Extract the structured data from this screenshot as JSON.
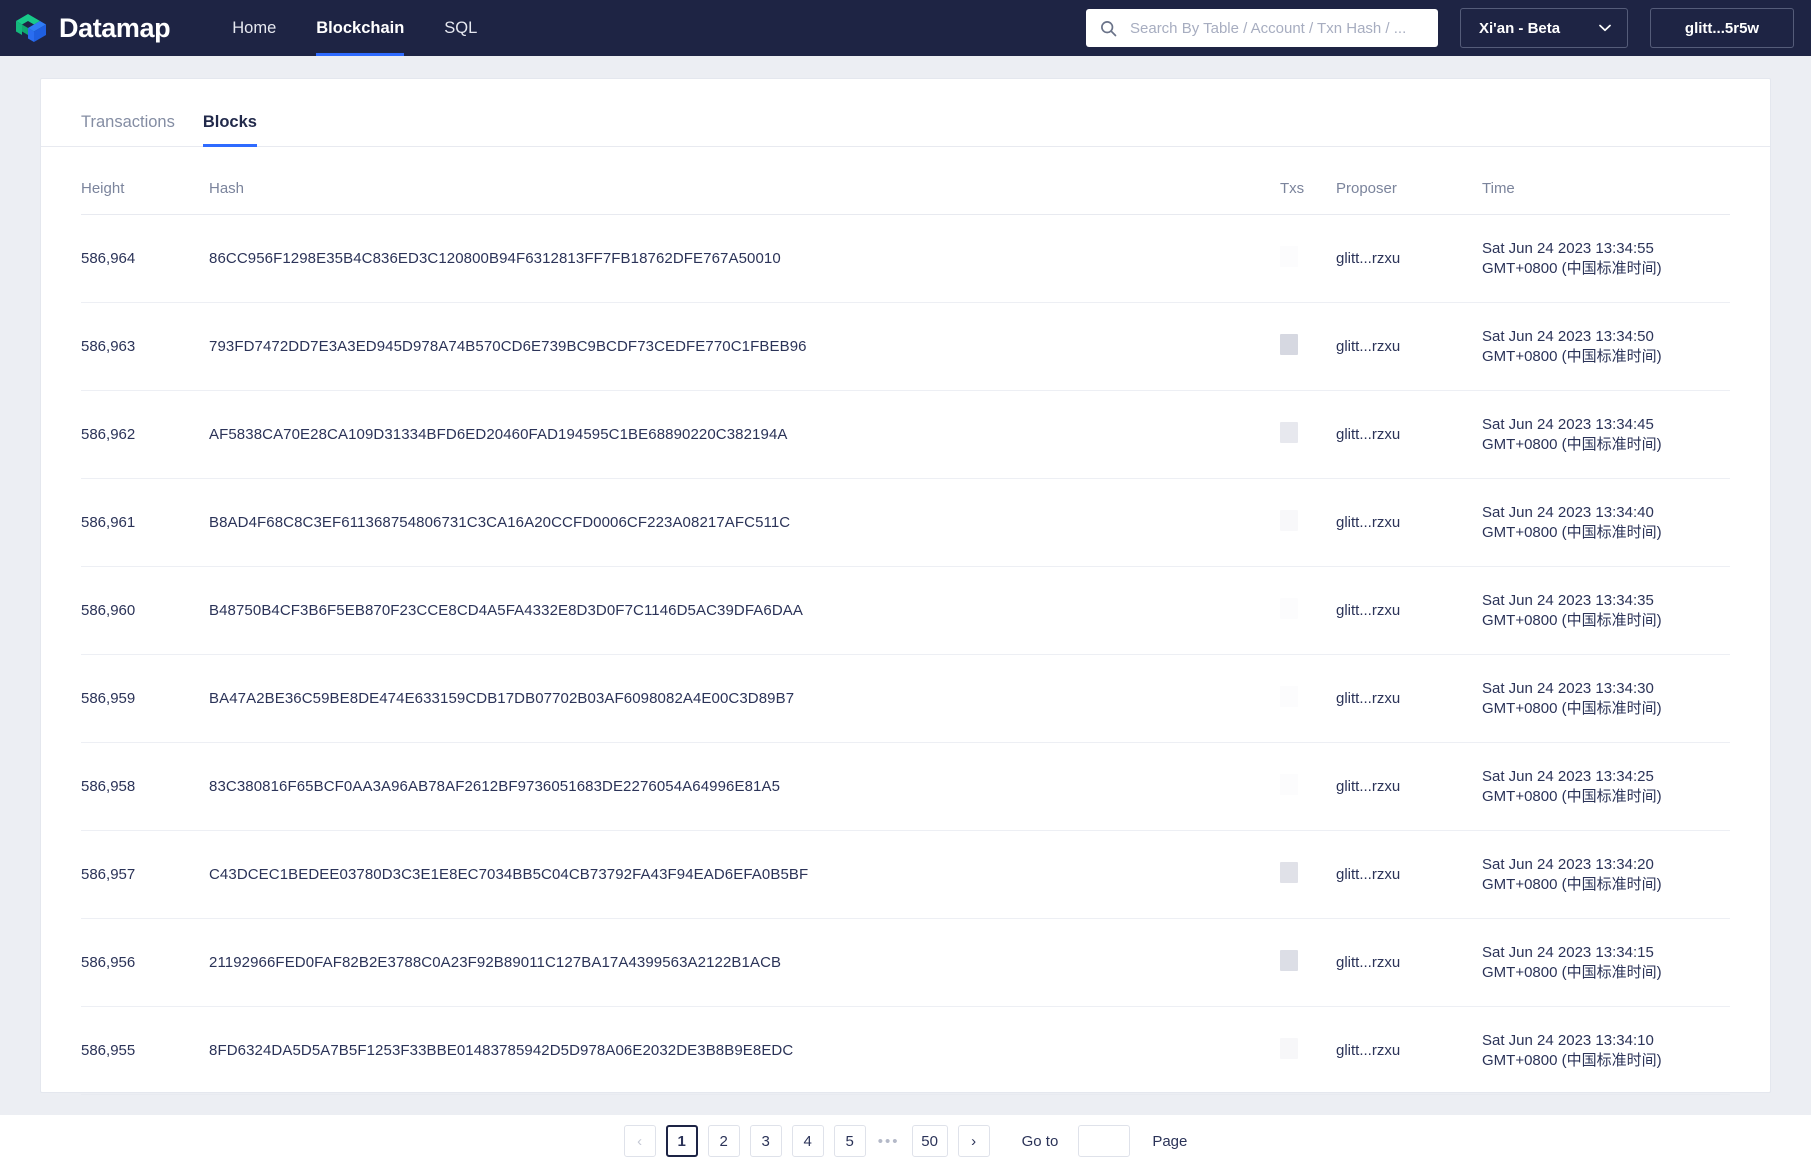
{
  "header": {
    "brand": "Datamap",
    "logo_icon": "datamap-logo-icon",
    "nav": [
      {
        "label": "Home",
        "active": false
      },
      {
        "label": "Blockchain",
        "active": true
      },
      {
        "label": "SQL",
        "active": false
      }
    ],
    "search": {
      "icon": "search-icon",
      "placeholder": "Search By Table / Account / Txn Hash / ...",
      "value": ""
    },
    "network": {
      "label": "Xi'an - Beta",
      "chevron": "chevron-down-icon"
    },
    "account": {
      "label": "glitt...5r5w"
    },
    "accent_color": "#2f6bff",
    "nav_background": "#1e2444"
  },
  "tabs": [
    {
      "label": "Transactions",
      "active": false
    },
    {
      "label": "Blocks",
      "active": true
    }
  ],
  "table": {
    "columns": [
      "Height",
      "Hash",
      "Txs",
      "Proposer",
      "Time"
    ],
    "rows": [
      {
        "height": "586,964",
        "hash": "86CC956F1298E35B4C836ED3C120800B94F6312813FF7FB18762DFE767A50010",
        "txs": "",
        "txs_skeleton_opacity": 0.05,
        "proposer": "glitt...rzxu",
        "time_line1": "Sat Jun 24 2023 13:34:55",
        "time_line2": "GMT+0800 (中国标准时间)"
      },
      {
        "height": "586,963",
        "hash": "793FD7472DD7E3A3ED945D978A74B570CD6E739BC9BCDF73CEDFE770C1FBEB96",
        "txs": "",
        "txs_skeleton_opacity": 0.72,
        "proposer": "glitt...rzxu",
        "time_line1": "Sat Jun 24 2023 13:34:50",
        "time_line2": "GMT+0800 (中国标准时间)"
      },
      {
        "height": "586,962",
        "hash": "AF5838CA70E28CA109D31334BFD6ED20460FAD194595C1BE68890220C382194A",
        "txs": "",
        "txs_skeleton_opacity": 0.42,
        "proposer": "glitt...rzxu",
        "time_line1": "Sat Jun 24 2023 13:34:45",
        "time_line2": "GMT+0800 (中国标准时间)"
      },
      {
        "height": "586,961",
        "hash": "B8AD4F68C8C3EF611368754806731C3CA16A20CCFD0006CF223A08217AFC511C",
        "txs": "",
        "txs_skeleton_opacity": 0.12,
        "proposer": "glitt...rzxu",
        "time_line1": "Sat Jun 24 2023 13:34:40",
        "time_line2": "GMT+0800 (中国标准时间)"
      },
      {
        "height": "586,960",
        "hash": "B48750B4CF3B6F5EB870F23CCE8CD4A5FA4332E8D3D0F7C1146D5AC39DFA6DAA",
        "txs": "",
        "txs_skeleton_opacity": 0.06,
        "proposer": "glitt...rzxu",
        "time_line1": "Sat Jun 24 2023 13:34:35",
        "time_line2": "GMT+0800 (中国标准时间)"
      },
      {
        "height": "586,959",
        "hash": "BA47A2BE36C59BE8DE474E633159CDB17DB07702B03AF6098082A4E00C3D89B7",
        "txs": "",
        "txs_skeleton_opacity": 0.05,
        "proposer": "glitt...rzxu",
        "time_line1": "Sat Jun 24 2023 13:34:30",
        "time_line2": "GMT+0800 (中国标准时间)"
      },
      {
        "height": "586,958",
        "hash": "83C380816F65BCF0AA3A96AB78AF2612BF9736051683DE2276054A64996E81A5",
        "txs": "",
        "txs_skeleton_opacity": 0.05,
        "proposer": "glitt...rzxu",
        "time_line1": "Sat Jun 24 2023 13:34:25",
        "time_line2": "GMT+0800 (中国标准时间)"
      },
      {
        "height": "586,957",
        "hash": "C43DCEC1BEDEE03780D3C3E1E8EC7034BB5C04CB73792FA43F94EAD6EFA0B5BF",
        "txs": "",
        "txs_skeleton_opacity": 0.55,
        "proposer": "glitt...rzxu",
        "time_line1": "Sat Jun 24 2023 13:34:20",
        "time_line2": "GMT+0800 (中国标准时间)"
      },
      {
        "height": "586,956",
        "hash": "21192966FED0FAF82B2E3788C0A23F92B89011C127BA17A4399563A2122B1ACB",
        "txs": "",
        "txs_skeleton_opacity": 0.62,
        "proposer": "glitt...rzxu",
        "time_line1": "Sat Jun 24 2023 13:34:15",
        "time_line2": "GMT+0800 (中国标准时间)"
      },
      {
        "height": "586,955",
        "hash": "8FD6324DA5D5A7B5F1253F33BBE01483785942D5D978A06E2032DE3B8B9E8EDC",
        "txs": "",
        "txs_skeleton_opacity": 0.14,
        "proposer": "glitt...rzxu",
        "time_line1": "Sat Jun 24 2023 13:34:10",
        "time_line2": "GMT+0800 (中国标准时间)"
      }
    ]
  },
  "pagination": {
    "prev": "‹",
    "next": "›",
    "pages": [
      "1",
      "2",
      "3",
      "4",
      "5"
    ],
    "ellipsis": "•••",
    "last_page": "50",
    "current_page": "1",
    "goto_label": "Go to",
    "goto_value": "",
    "page_label": "Page"
  }
}
